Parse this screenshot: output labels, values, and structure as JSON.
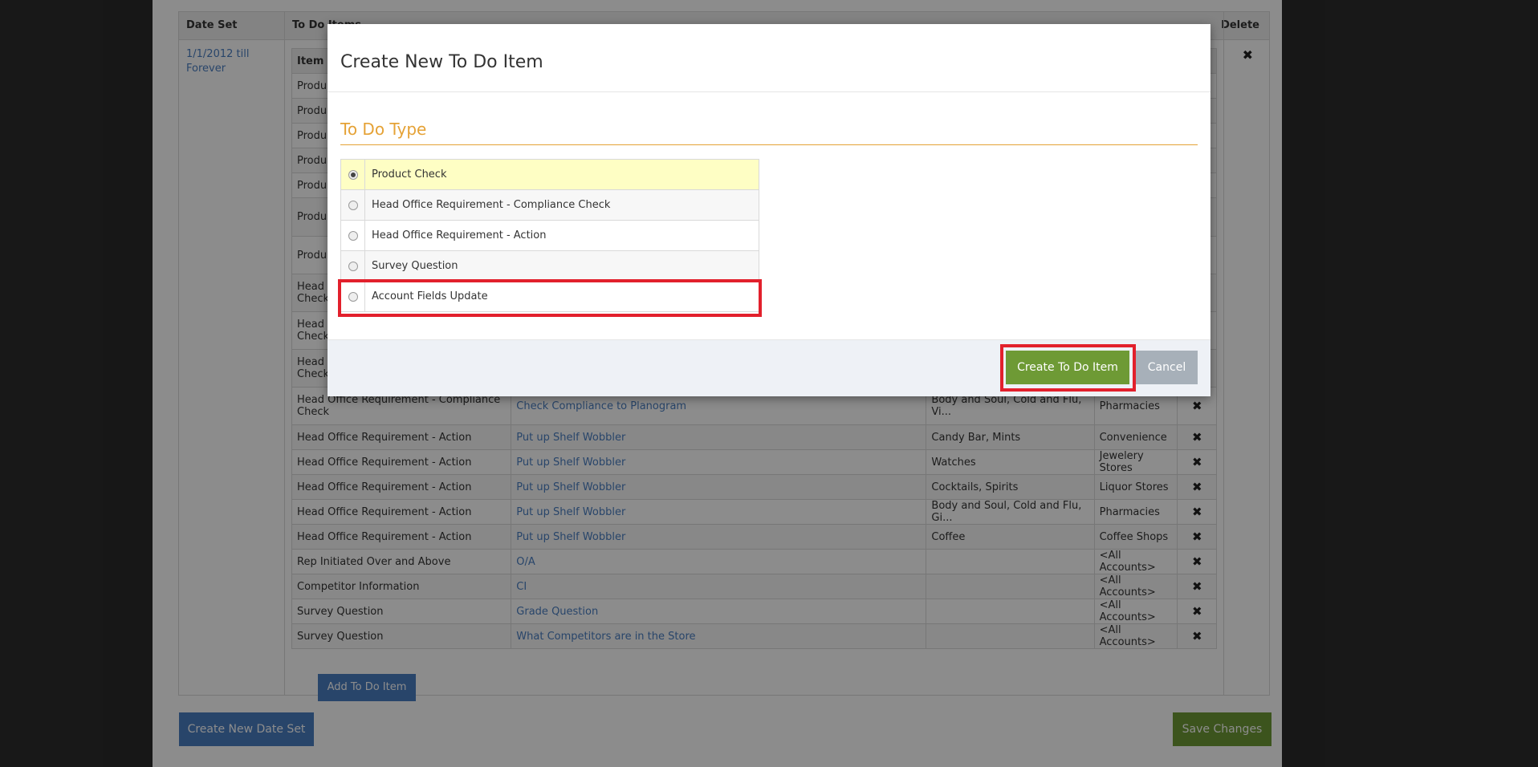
{
  "date_sets": {
    "headers": {
      "date_set": "Date Set",
      "todo_items": "To Do Items",
      "delete": "Delete"
    },
    "date_set_link": "1/1/2012 till Forever",
    "delete_icon": "✖",
    "todo_table": {
      "header_item_type": "Item T",
      "rows": [
        {
          "type": "Produ",
          "name": "",
          "products": "",
          "accounts": ""
        },
        {
          "type": "Produ",
          "name": "",
          "products": "",
          "accounts": ""
        },
        {
          "type": "Produ",
          "name": "",
          "products": "",
          "accounts": ""
        },
        {
          "type": "Produ",
          "name": "",
          "products": "",
          "accounts": ""
        },
        {
          "type": "Produ",
          "name": "",
          "products": "",
          "accounts": ""
        },
        {
          "type": "Produ",
          "name": "",
          "products": "",
          "accounts": ""
        },
        {
          "type": "Produ",
          "name": "",
          "products": "",
          "accounts": ""
        },
        {
          "type": "Head C\nCheck",
          "name": "",
          "products": "",
          "accounts": ""
        },
        {
          "type": "Head C\nCheck",
          "name": "",
          "products": "",
          "accounts": ""
        },
        {
          "type": "Head C\nCheck",
          "name": "",
          "products": "",
          "accounts": ""
        },
        {
          "type": "Head Office Requirement - Compliance Check",
          "name": "Check Compliance to Planogram",
          "products": "Body and Soul, Cold and Flu, Vi...",
          "accounts": "Pharmacies"
        },
        {
          "type": "Head Office Requirement - Action",
          "name": "Put up Shelf Wobbler",
          "products": "Candy Bar, Mints",
          "accounts": "Convenience"
        },
        {
          "type": "Head Office Requirement - Action",
          "name": "Put up Shelf Wobbler",
          "products": "Watches",
          "accounts": "Jewelery Stores"
        },
        {
          "type": "Head Office Requirement - Action",
          "name": "Put up Shelf Wobbler",
          "products": "Cocktails, Spirits",
          "accounts": "Liquor Stores"
        },
        {
          "type": "Head Office Requirement - Action",
          "name": "Put up Shelf Wobbler",
          "products": "Body and Soul, Cold and Flu, Gi...",
          "accounts": "Pharmacies"
        },
        {
          "type": "Head Office Requirement - Action",
          "name": "Put up Shelf Wobbler",
          "products": "Coffee",
          "accounts": "Coffee Shops"
        },
        {
          "type": "Rep Initiated Over and Above",
          "name": "O/A",
          "products": "",
          "accounts": "<All Accounts>"
        },
        {
          "type": "Competitor Information",
          "name": "CI",
          "products": "",
          "accounts": "<All Accounts>"
        },
        {
          "type": "Survey Question",
          "name": "Grade Question",
          "products": "",
          "accounts": "<All Accounts>"
        },
        {
          "type": "Survey Question",
          "name": "What Competitors are in the Store",
          "products": "",
          "accounts": "<All Accounts>"
        }
      ]
    },
    "add_todo_label": "Add To Do Item",
    "create_date_set_label": "Create New Date Set",
    "save_changes_label": "Save Changes"
  },
  "modal": {
    "title": "Create New To Do Item",
    "section_title": "To Do Type",
    "types": [
      {
        "label": "Product Check",
        "selected": true
      },
      {
        "label": "Head Office Requirement - Compliance Check",
        "selected": false
      },
      {
        "label": "Head Office Requirement - Action",
        "selected": false
      },
      {
        "label": "Survey Question",
        "selected": false
      },
      {
        "label": "Account Fields Update",
        "selected": false
      }
    ],
    "create_label": "Create To Do Item",
    "cancel_label": "Cancel"
  },
  "colors": {
    "primary_blue": "#4a7ec2",
    "success_green": "#6e9a35",
    "accent_orange": "#e5a236",
    "highlight_red": "#e2202c",
    "selected_row": "#fefec4"
  }
}
